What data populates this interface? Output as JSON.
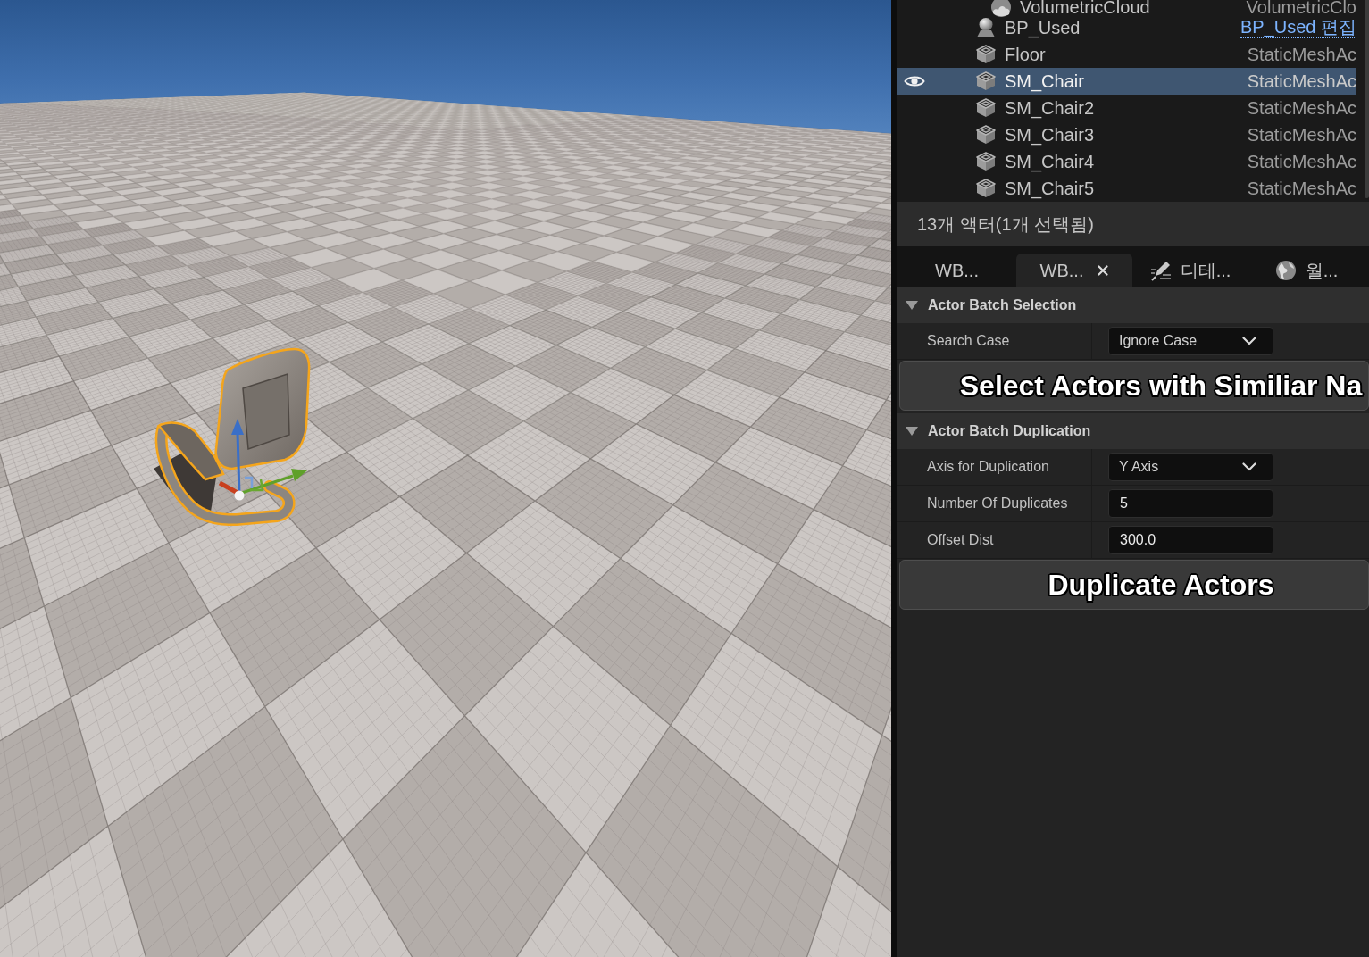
{
  "viewport": {
    "chair": {
      "selected": true
    }
  },
  "outliner": {
    "rows": [
      {
        "name": "VolumetricCloud",
        "kind": "cloud",
        "type": {
          "kind": "text",
          "text": "VolumetricClo"
        },
        "selected": false
      },
      {
        "name": "BP_Used",
        "kind": "blueprint",
        "type": {
          "kind": "link",
          "text": "BP_Used 편집"
        },
        "selected": false
      },
      {
        "name": "Floor",
        "kind": "mesh",
        "type": {
          "kind": "text",
          "text": "StaticMeshAc"
        },
        "selected": false
      },
      {
        "name": "SM_Chair",
        "kind": "mesh",
        "type": {
          "kind": "text",
          "text": "StaticMeshAc"
        },
        "selected": true
      },
      {
        "name": "SM_Chair2",
        "kind": "mesh",
        "type": {
          "kind": "text",
          "text": "StaticMeshAc"
        },
        "selected": false
      },
      {
        "name": "SM_Chair3",
        "kind": "mesh",
        "type": {
          "kind": "text",
          "text": "StaticMeshAc"
        },
        "selected": false
      },
      {
        "name": "SM_Chair4",
        "kind": "mesh",
        "type": {
          "kind": "text",
          "text": "StaticMeshAc"
        },
        "selected": false
      },
      {
        "name": "SM_Chair5",
        "kind": "mesh",
        "type": {
          "kind": "text",
          "text": "StaticMeshAc"
        },
        "selected": false
      }
    ],
    "status": "13개 액터(1개 선택됨)"
  },
  "tabs": [
    {
      "label": "WB...",
      "kind": "widget",
      "selected": false
    },
    {
      "label": "WB...",
      "kind": "widget",
      "selected": true
    },
    {
      "label": "디테...",
      "kind": "details",
      "selected": false
    },
    {
      "label": "월...",
      "kind": "world",
      "selected": false
    }
  ],
  "details": {
    "categories": [
      {
        "title": "Actor Batch Selection",
        "expanded": true,
        "properties": [
          {
            "label": "Search Case",
            "kind": "dropdown",
            "value": "Ignore Case"
          }
        ],
        "button": "Select Actors with Similiar Na"
      },
      {
        "title": "Actor Batch Duplication",
        "expanded": true,
        "properties": [
          {
            "label": "Axis for Duplication",
            "kind": "dropdown",
            "value": "Y Axis"
          },
          {
            "label": "Number Of Duplicates",
            "kind": "number",
            "value": "5"
          },
          {
            "label": "Offset Dist",
            "kind": "number",
            "value": "300.0"
          }
        ],
        "button": "Duplicate Actors"
      }
    ]
  }
}
